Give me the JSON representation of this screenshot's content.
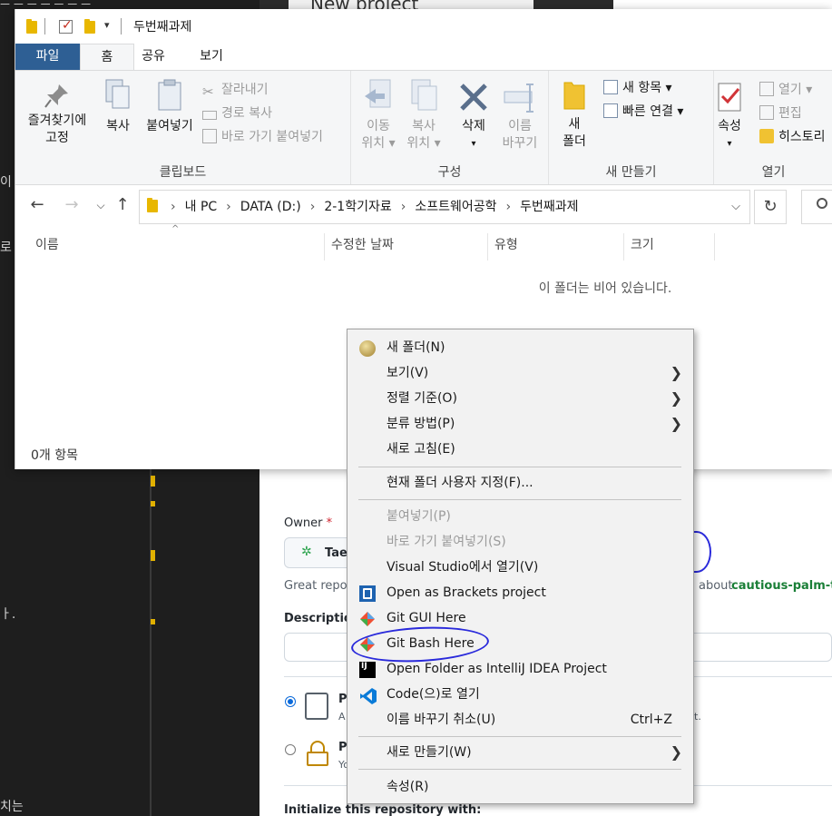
{
  "editor": {
    "frag1": "이",
    "frag2": "로",
    "frag3": "ㅏ.",
    "frag4": "치는"
  },
  "github": {
    "new_project": "New project",
    "owner_label": "Owner",
    "owner_required": "*",
    "owner_value": "TaeV",
    "great_repos": "Great repos",
    "about_text": "about",
    "suggested_name": "cautious-palm-tre",
    "description_label": "Description",
    "public_initial": "P",
    "public_desc": "A",
    "private_initial": "P",
    "private_desc": "Yo",
    "it_text": "it.",
    "init_text": "Initialize this repository with:"
  },
  "explorer": {
    "title": "두번째과제",
    "tabs": [
      "파일",
      "홈",
      "공유",
      "보기"
    ],
    "clipboard": {
      "pin": [
        "즐겨찾기에",
        "고정"
      ],
      "copy": "복사",
      "paste": "붙여넣기",
      "cut": "잘라내기",
      "copy_path": "경로 복사",
      "paste_shortcut": "바로 가기 붙여넣기",
      "label": "클립보드"
    },
    "organize": {
      "move_to": [
        "이동",
        "위치 ▾"
      ],
      "copy_to": [
        "복사",
        "위치 ▾"
      ],
      "delete": [
        "삭제",
        "▾"
      ],
      "rename": [
        "이름",
        "바꾸기"
      ],
      "label": "구성"
    },
    "new": {
      "new_folder": [
        "새",
        "폴더"
      ],
      "new_item": "새 항목 ▾",
      "easy_access": "빠른 연결 ▾",
      "label": "새 만들기"
    },
    "open": {
      "properties": [
        "속성",
        "▾"
      ],
      "open": "열기 ▾",
      "edit": "편집",
      "history": "히스토리",
      "label": "열기"
    },
    "breadcrumbs": [
      "내 PC",
      "DATA (D:)",
      "2-1학기자료",
      "소프트웨어공학",
      "두번째과제"
    ],
    "columns": [
      "이름",
      "수정한 날짜",
      "유형",
      "크기"
    ],
    "empty_message": "이 폴더는 비어 있습니다.",
    "status": "0개 항목"
  },
  "context_menu": {
    "items": [
      {
        "label": "새 폴더(N)"
      },
      {
        "label": "보기(V)"
      },
      {
        "label": "정렬 기준(O)"
      },
      {
        "label": "분류 방법(P)"
      },
      {
        "label": "새로 고침(E)"
      },
      {
        "label": "현재 폴더 사용자 지정(F)..."
      },
      {
        "label": "붙여넣기(P)"
      },
      {
        "label": "바로 가기 붙여넣기(S)"
      },
      {
        "label": "Visual Studio에서 열기(V)"
      },
      {
        "label": "Open as Brackets project"
      },
      {
        "label": "Git GUI Here"
      },
      {
        "label": "Git Bash Here"
      },
      {
        "label": "Open Folder as IntelliJ IDEA Project"
      },
      {
        "label": "Code(으)로 열기"
      },
      {
        "label": "이름 바꾸기 취소(U)",
        "shortcut": "Ctrl+Z"
      },
      {
        "label": "새로 만들기(W)"
      },
      {
        "label": "속성(R)"
      }
    ]
  },
  "colors": {
    "file_tab": "#2e5f94",
    "annotation": "#2a2adb",
    "folder": "#e8b700",
    "gh_link": "#1a7f37"
  }
}
